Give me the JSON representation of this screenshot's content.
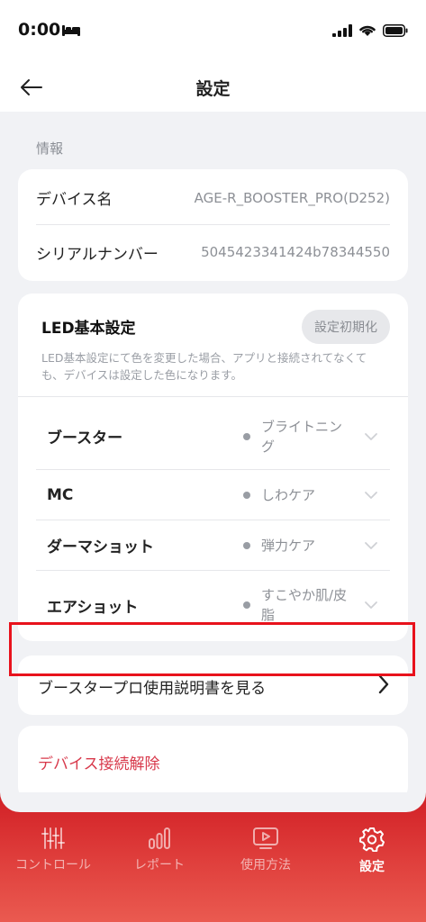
{
  "status": {
    "time": "0:00"
  },
  "nav": {
    "title": "設定"
  },
  "info": {
    "section_label": "情報",
    "device_name_key": "デバイス名",
    "device_name_value": "AGE-R_BOOSTER_PRO(D252)",
    "serial_key": "シリアルナンバー",
    "serial_value": "5045423341424b78344550"
  },
  "led": {
    "title": "LED基本設定",
    "reset_label": "設定初期化",
    "description": "LED基本設定にて色を変更した場合、アプリと接続されてなくても、デバイスは設定した色になります。",
    "rows": [
      {
        "name": "ブースター",
        "value": "ブライトニング"
      },
      {
        "name": "MC",
        "value": "しわケア"
      },
      {
        "name": "ダーマショット",
        "value": "弾力ケア"
      },
      {
        "name": "エアショット",
        "value": "すこやか肌/皮脂"
      }
    ]
  },
  "manual": {
    "label": "ブースタープロ使用説明書を見る"
  },
  "disconnect": {
    "label": "デバイス接続解除"
  },
  "tabs": [
    {
      "label": "コントロール",
      "icon": "sliders-icon"
    },
    {
      "label": "レポート",
      "icon": "report-icon"
    },
    {
      "label": "使用方法",
      "icon": "video-icon"
    },
    {
      "label": "設定",
      "icon": "gear-icon",
      "active": true
    }
  ],
  "colors": {
    "accent": "#d8394b",
    "tabbar": "#d11f25",
    "background": "#f1f2f5"
  }
}
